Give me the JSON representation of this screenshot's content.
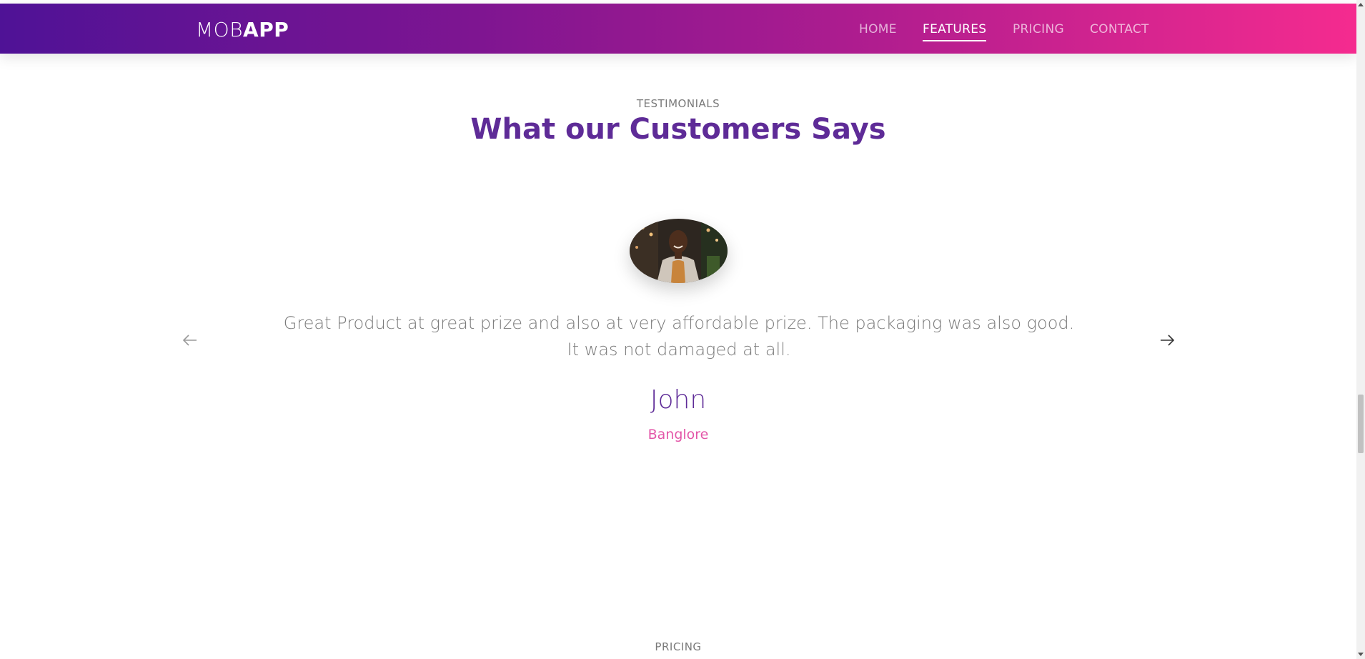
{
  "navbar": {
    "logo_light": "MOB",
    "logo_bold": "APP",
    "items": [
      {
        "label": "HOME"
      },
      {
        "label": "FEATURES"
      },
      {
        "label": "PRICING"
      },
      {
        "label": "CONTACT"
      }
    ],
    "active_item": "FEATURES"
  },
  "testimonials": {
    "eyebrow": "TESTIMONIALS",
    "title": "What our Customers Says",
    "quote": "Great Product at great prize and also at very affordable prize. The packaging was also good. It was not damaged at all.",
    "name": "John",
    "city": "Banglore"
  },
  "next_section": {
    "eyebrow": "PRICING"
  },
  "icons": {
    "prev": "arrow-left-icon",
    "next": "arrow-right-icon"
  },
  "colors": {
    "gradient_start": "#4f1296",
    "gradient_end": "#f52b8f",
    "title": "#5e2b97",
    "city": "#e356a8",
    "body_text": "#7a7a7a"
  }
}
